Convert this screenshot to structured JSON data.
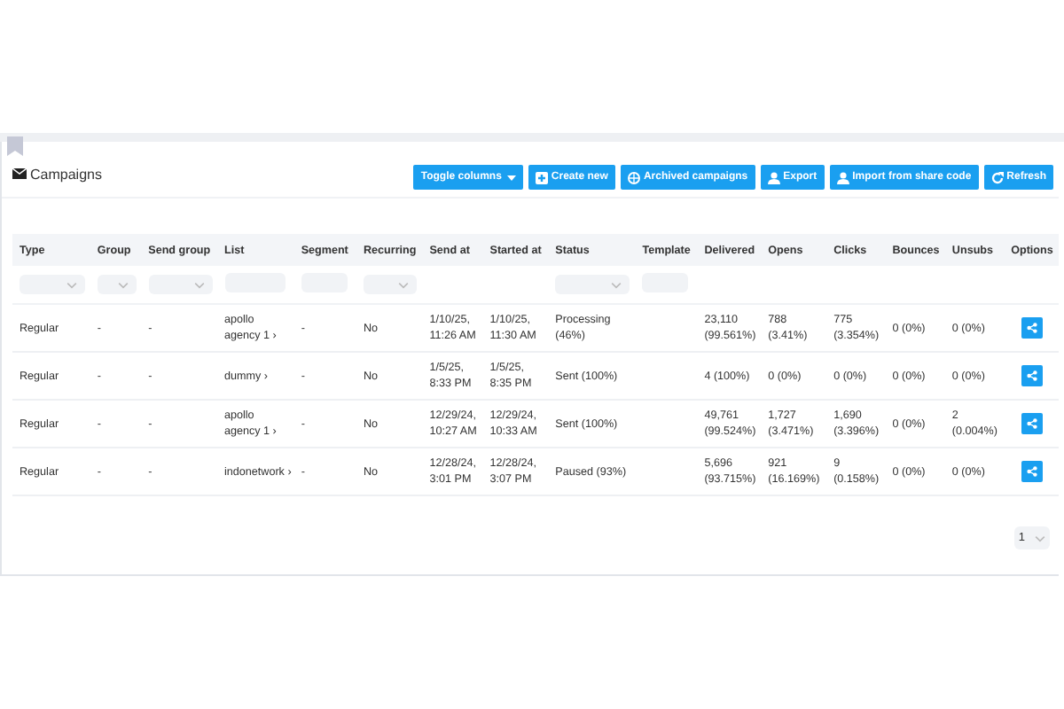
{
  "header": {
    "title": "Campaigns"
  },
  "buttons": [
    {
      "label": "Toggle columns",
      "kind": "dropdown"
    },
    {
      "label": "Create new",
      "kind": "create"
    },
    {
      "label": "Archived campaigns",
      "kind": "archive"
    },
    {
      "label": "Export",
      "kind": "export"
    },
    {
      "label": "Import from share code",
      "kind": "import"
    },
    {
      "label": "Refresh",
      "kind": "refresh"
    }
  ],
  "table": {
    "columns": [
      {
        "label": "Type",
        "kind": "select"
      },
      {
        "label": "Group",
        "kind": "select"
      },
      {
        "label": "Send group",
        "kind": "select"
      },
      {
        "label": "List",
        "kind": "input"
      },
      {
        "label": "Segment",
        "kind": "input"
      },
      {
        "label": "Recurring",
        "kind": "select"
      },
      {
        "label": "Send at"
      },
      {
        "label": "Started at"
      },
      {
        "label": "Status",
        "kind": "select"
      },
      {
        "label": "Template",
        "kind": "input"
      },
      {
        "label": "Delivered"
      },
      {
        "label": "Opens"
      },
      {
        "label": "Clicks"
      },
      {
        "label": "Bounces"
      },
      {
        "label": "Unsubs"
      },
      {
        "label": "Options"
      }
    ],
    "rows": [
      [
        "Regular",
        "-",
        "-",
        "apollo agency 1 ›",
        "-",
        "No",
        "1/10/25, 11:26 AM",
        "1/10/25, 11:30 AM",
        "Processing (46%)",
        "",
        "23,110 (99.561%)",
        "788 (3.41%)",
        "775 (3.354%)",
        "0 (0%)",
        "0 (0%)"
      ],
      [
        "Regular",
        "-",
        "-",
        "dummy ›",
        "-",
        "No",
        "1/5/25, 8:33 PM",
        "1/5/25, 8:35 PM",
        "Sent (100%)",
        "",
        "4 (100%)",
        "0 (0%)",
        "0 (0%)",
        "0 (0%)",
        "0 (0%)"
      ],
      [
        "Regular",
        "-",
        "-",
        "apollo agency 1 ›",
        "-",
        "No",
        "12/29/24, 10:27 AM",
        "12/29/24, 10:33 AM",
        "Sent (100%)",
        "",
        "49,761 (99.524%)",
        "1,727 (3.471%)",
        "1,690 (3.396%)",
        "0 (0%)",
        "2 (0.004%)"
      ],
      [
        "Regular",
        "-",
        "-",
        "indonetwork ›",
        "-",
        "No",
        "12/28/24, 3:01 PM",
        "12/28/24, 3:07 PM",
        "Paused (93%)",
        "",
        "5,696 (93.715%)",
        "921 (16.169%)",
        "9 (0.158%)",
        "0 (0%)",
        "0 (0%)"
      ]
    ]
  },
  "pagination": {
    "page": "1"
  }
}
